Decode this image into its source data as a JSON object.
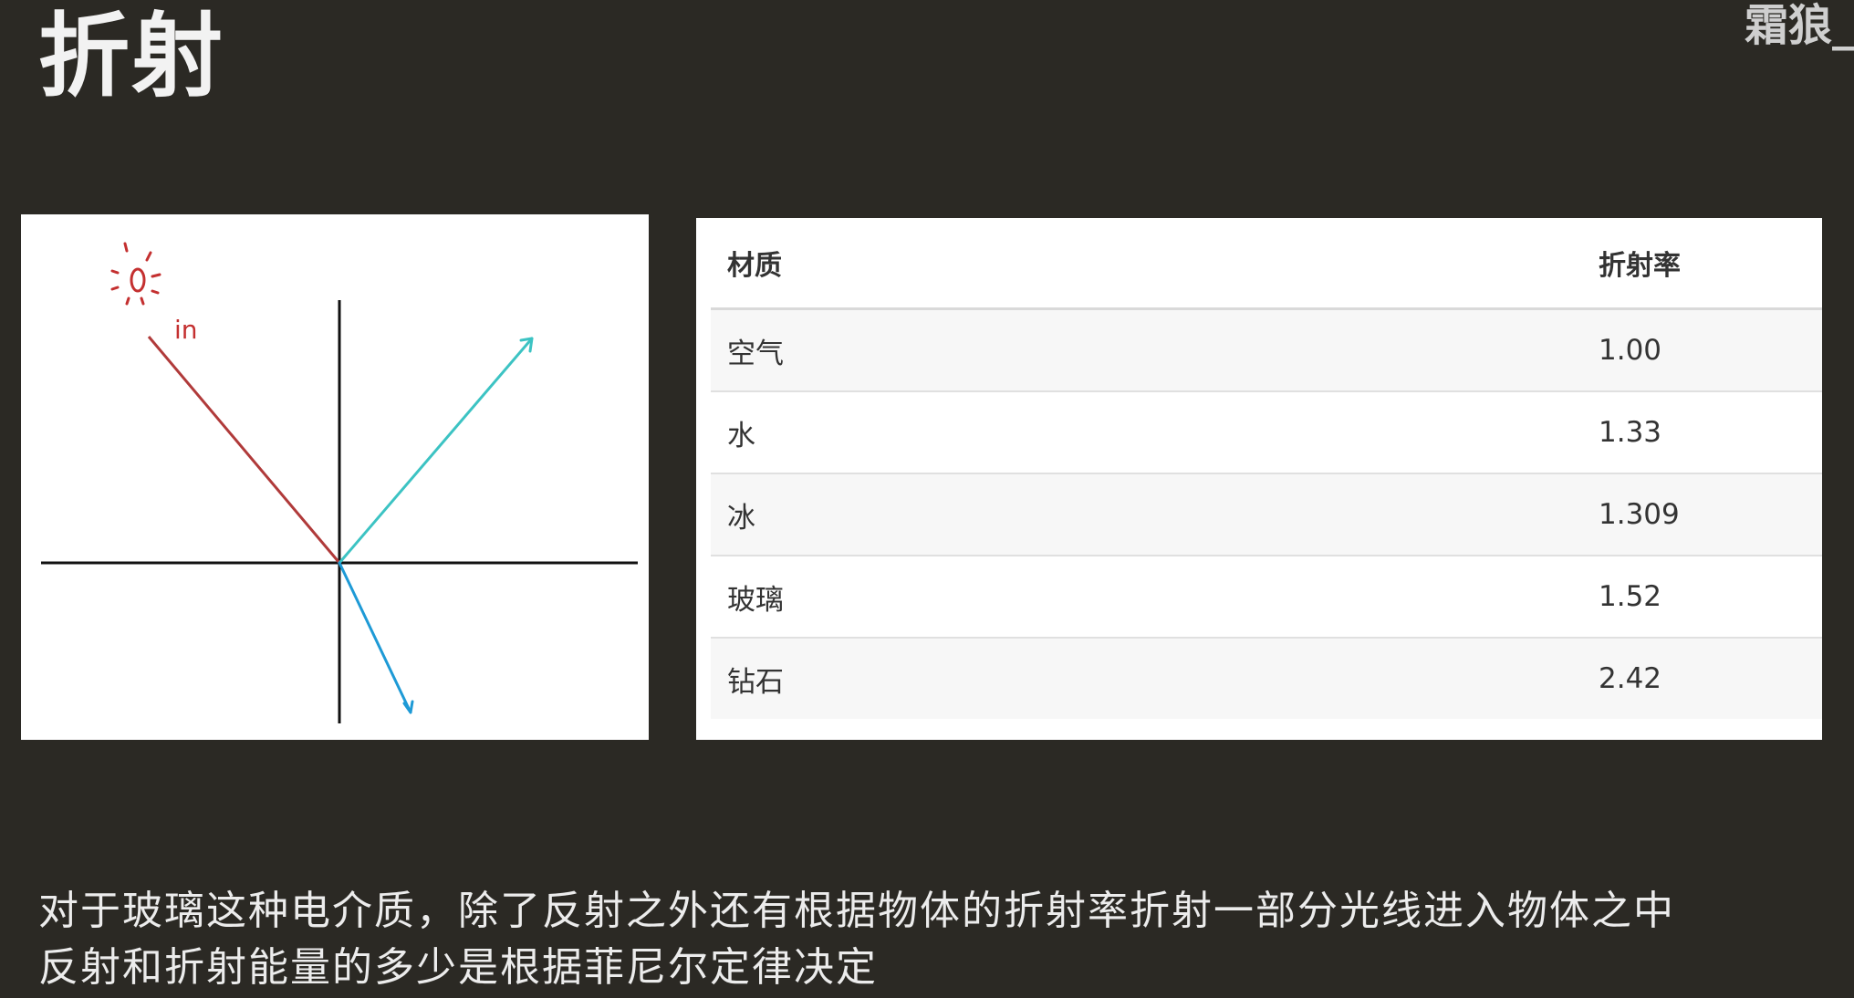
{
  "slide": {
    "title": "折射",
    "watermark": "霜狼_"
  },
  "diagram": {
    "incoming_label": "in",
    "colors": {
      "incident_ray": "#b03a3a",
      "reflected_ray": "#3cc3c3",
      "refracted_ray": "#1e9ad6",
      "light_source": "#c43030",
      "axes": "#111111"
    }
  },
  "table": {
    "headers": [
      "材质",
      "折射率"
    ],
    "rows": [
      {
        "material": "空气",
        "ior": "1.00"
      },
      {
        "material": "水",
        "ior": "1.33"
      },
      {
        "material": "冰",
        "ior": "1.309"
      },
      {
        "material": "玻璃",
        "ior": "1.52"
      },
      {
        "material": "钻石",
        "ior": "2.42"
      }
    ]
  },
  "caption": {
    "line1": "对于玻璃这种电介质，除了反射之外还有根据物体的折射率折射一部分光线进入物体之中",
    "line2": "反射和折射能量的多少是根据菲尼尔定律决定"
  }
}
